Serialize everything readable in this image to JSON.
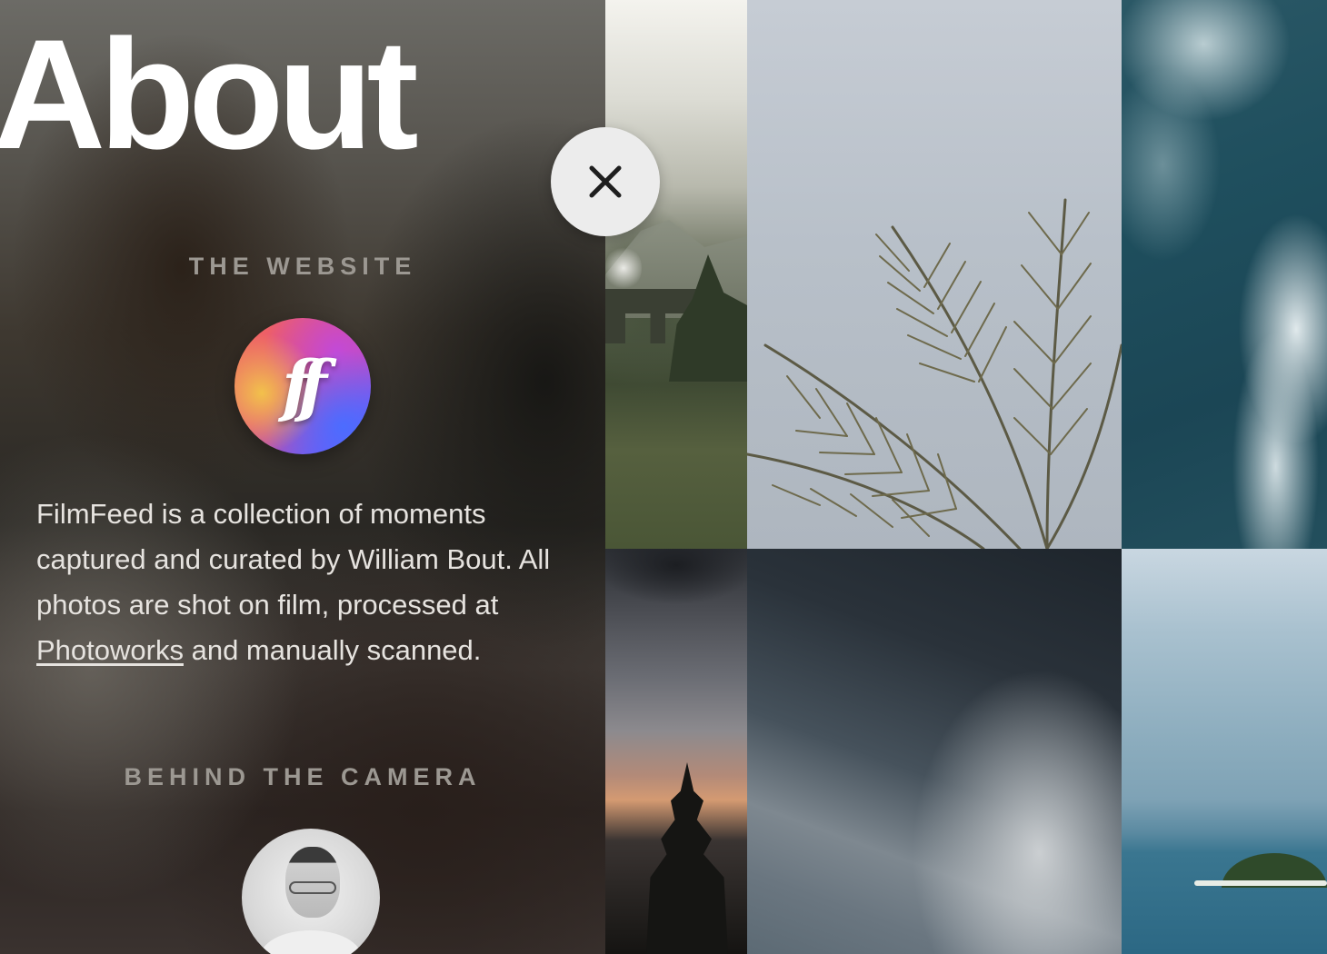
{
  "about": {
    "title": "About",
    "website_heading": "THE WEBSITE",
    "logo_mark": "ff",
    "description_before_link": "FilmFeed is a collection of moments captured and curated by William Bout. All photos are shot on film, processed at ",
    "description_link": "Photoworks",
    "description_after_link": " and manually scanned.",
    "camera_heading": "BEHIND THE CAMERA"
  },
  "close_button": {
    "icon": "close-icon"
  },
  "gallery": {
    "photos": [
      {
        "name": "photo-mountain-train-bridge"
      },
      {
        "name": "photo-palm-leaves"
      },
      {
        "name": "photo-ocean-waves-aerial"
      },
      {
        "name": "photo-sunset-tree-silhouette"
      },
      {
        "name": "photo-dark-sky-gradient"
      },
      {
        "name": "photo-tropical-island"
      }
    ]
  },
  "colors": {
    "heading_gray": "#9c9892",
    "title_white": "#ffffff",
    "close_button_bg": "#ececec"
  }
}
